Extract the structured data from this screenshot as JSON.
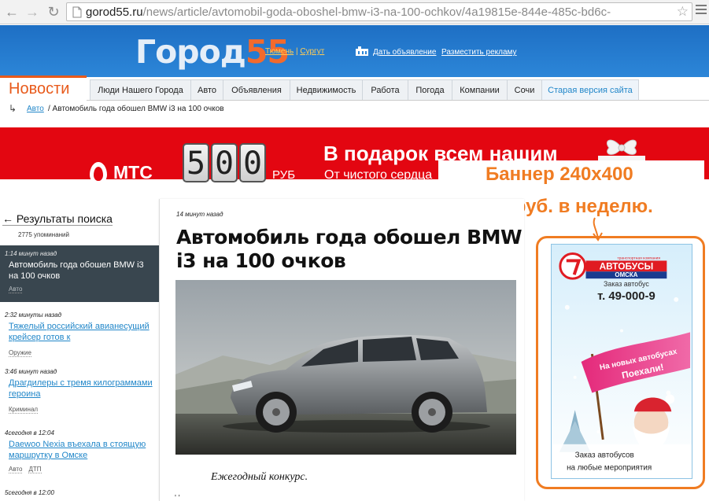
{
  "browser": {
    "url_host": "gorod55.ru",
    "url_path": "/news/article/avtomobil-goda-oboshel-bmw-i3-na-100-ochkov/4a19815e-844e-485c-bd6c-"
  },
  "header": {
    "logo_text": "Город",
    "logo_number": "55",
    "city_1": "Тюмень",
    "city_sep": " | ",
    "city_2": "Сургут",
    "link_ad": "Дать объявление",
    "link_advert": "Разместить рекламу"
  },
  "section_title": "Новости",
  "tabs": [
    {
      "label": "Люди Нашего Города"
    },
    {
      "label": "Авто"
    },
    {
      "label": "Объявления"
    },
    {
      "label": "Недвижимость"
    },
    {
      "label": "Работа"
    },
    {
      "label": "Погода"
    },
    {
      "label": "Компании"
    },
    {
      "label": "Сочи"
    },
    {
      "label": "Старая версия сайта"
    }
  ],
  "breadcrumb": {
    "link": "Авто",
    "current": " / Автомобиль года обошел BMW i3 на 100 очков"
  },
  "mts_banner": {
    "brand": "МТС",
    "digits": [
      "5",
      "0",
      "0"
    ],
    "currency": "РУБ",
    "headline": "В подарок всем нашим",
    "subline": "От чистого сердца"
  },
  "annotation": {
    "line1": "Баннер 240x400",
    "line2": "7 500 руб. в неделю."
  },
  "sidebar": {
    "back_label": "← Результаты поиска",
    "mentions": "2775 упоминаний",
    "items": [
      {
        "time": "1:14 минут назад",
        "title": "Автомобиль года обошел BMW i3 на 100 очков",
        "tags": [
          "Авто"
        ]
      },
      {
        "time": "2:32 минуты назад",
        "title": "Тяжелый российский авианесущий крейсер готов к",
        "tags": [
          "Оружие"
        ]
      },
      {
        "time": "3:46 минут назад",
        "title": "Драгдилеры с тремя килограммами героина",
        "tags": [
          "Криминал"
        ]
      },
      {
        "time": "4сегодня в 12:04",
        "title": "Daewoo Nexia въехала в стоящую маршрутку в Омске",
        "tags": [
          "Авто",
          "ДТП"
        ]
      },
      {
        "time": "5сегодня в 12:00",
        "title": "",
        "tags": []
      }
    ]
  },
  "article": {
    "time": "14 минут назад",
    "title": "Автомобиль года обошел BMW i3 на 100 очков",
    "caption": "Ежегодный конкурс.",
    "fragment": "' '"
  },
  "side_banner": {
    "company_small": "транспортная компания",
    "company_1": "АВТОБУСЫ",
    "company_2": "ОМСКА",
    "order_label": "Заказ автобус",
    "phone": "т. 49-000-9",
    "flag_1": "На новых автобусах",
    "flag_2": "Поехали!",
    "bottom_1": "Заказ автобусов",
    "bottom_2": "на любые мероприятия"
  }
}
